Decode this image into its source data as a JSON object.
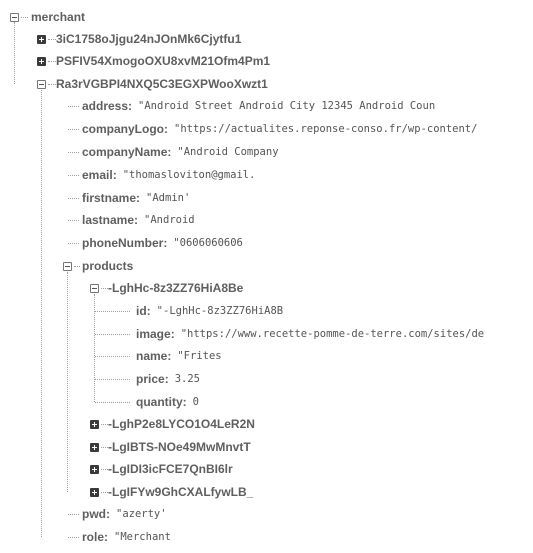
{
  "tree": {
    "root": {
      "label": "merchant"
    },
    "merchants": [
      {
        "id": "3iC1758oJjgu24nJOnMk6Cjytfu1"
      },
      {
        "id": "PSFIV54XmogoOXU8xvM21Ofm4Pm1"
      },
      {
        "id": "Ra3rVGBPI4NXQ5C3EGXPWooXwzt1"
      }
    ],
    "fields": {
      "address": {
        "key": "address",
        "value": "\"Android Street Android City 12345 Android Coun"
      },
      "companyLogo": {
        "key": "companyLogo",
        "value": "\"https://actualites.reponse-conso.fr/wp-content/"
      },
      "companyName": {
        "key": "companyName",
        "value": "\"Android Company"
      },
      "email": {
        "key": "email",
        "value": "\"thomasloviton@gmail.co"
      },
      "firstname": {
        "key": "firstname",
        "value": "\"Admin'"
      },
      "lastname": {
        "key": "lastname",
        "value": "\"Android"
      },
      "phoneNumber": {
        "key": "phoneNumber",
        "value": "\"0606060606"
      },
      "products": {
        "key": "products"
      },
      "pwd": {
        "key": "pwd",
        "value": "\"azerty'"
      },
      "role": {
        "key": "role",
        "value": "\"Merchant"
      }
    },
    "products": [
      {
        "id": "-LghHc-8z3ZZ76HiA8Be"
      },
      {
        "id": "-LghP2e8LYCO1O4LeR2N"
      },
      {
        "id": "-LgIBTS-NOe49MwMnvtT"
      },
      {
        "id": "-LgIDI3icFCE7QnBI6lr"
      },
      {
        "id": "-LgIFYw9GhCXALfywLB_"
      }
    ],
    "product_fields": {
      "id": {
        "key": "id",
        "value": "\"-LghHc-8z3ZZ76HiA8B"
      },
      "image": {
        "key": "image",
        "value": "\"https://www.recette-pomme-de-terre.com/sites/de"
      },
      "name": {
        "key": "name",
        "value": "\"Frites"
      },
      "price": {
        "key": "price",
        "value": "3.25"
      },
      "quantity": {
        "key": "quantity",
        "value": "0"
      }
    }
  }
}
